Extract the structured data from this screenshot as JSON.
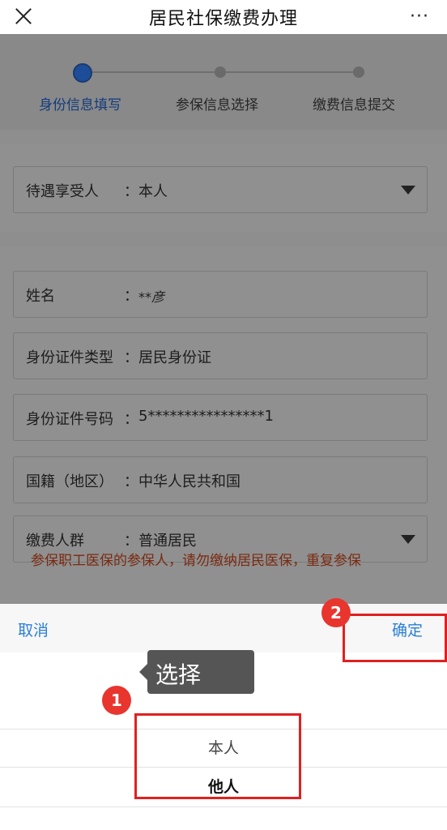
{
  "header": {
    "title": "居民社保缴费办理",
    "close_icon": "close-icon",
    "more_label": "···"
  },
  "steps": [
    {
      "label": "身份信息填写",
      "active": true
    },
    {
      "label": "参保信息选择",
      "active": false
    },
    {
      "label": "缴费信息提交",
      "active": false
    }
  ],
  "beneficiary": {
    "label": "待遇享受人",
    "colon": "：",
    "value": "本人"
  },
  "fields": [
    {
      "label": "姓名",
      "colon": "：",
      "value": "**彦"
    },
    {
      "label": "身份证件类型",
      "colon": "：",
      "value": "居民身份证"
    },
    {
      "label": "身份证件号码",
      "colon": "：",
      "value": "5****************1"
    },
    {
      "label": "国籍（地区）",
      "colon": "：",
      "value": "中华人民共和国"
    },
    {
      "label": "缴费人群",
      "colon": "：",
      "value": "普通居民"
    }
  ],
  "warning": "参保职工医保的参保人，请勿缴纳居民医保，重复参保",
  "picker": {
    "cancel": "取消",
    "confirm": "确定",
    "options": [
      "本人",
      "他人"
    ]
  },
  "annotations": {
    "badge1": "1",
    "badge2": "2",
    "tooltip": "选择",
    "accent_color": "#e02020"
  }
}
